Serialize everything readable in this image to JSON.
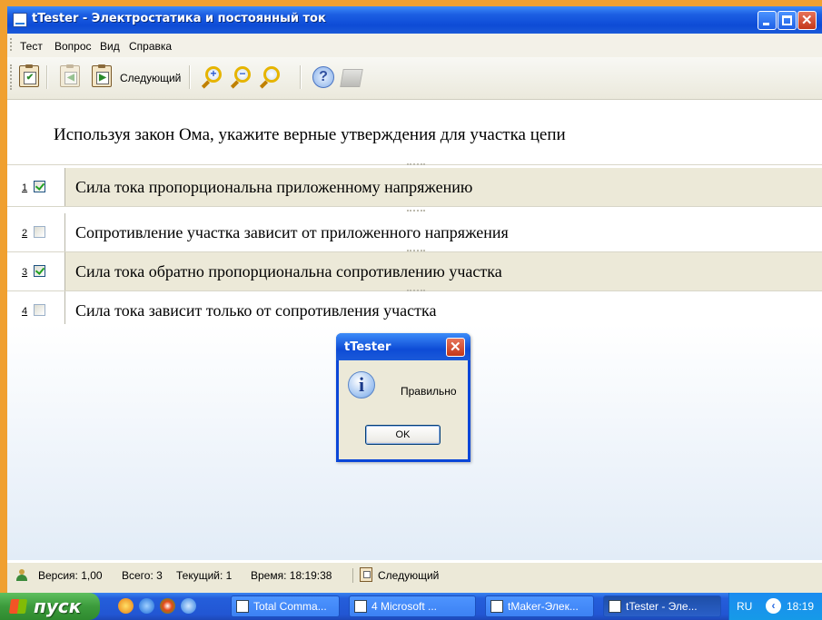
{
  "window": {
    "title": "tTester - Электростатика и постоянный ток"
  },
  "menu": [
    "Тест",
    "Вопрос",
    "Вид",
    "Справка"
  ],
  "toolbar": {
    "next_label": "Следующий"
  },
  "question": {
    "text": "Используя закон Ома, укажите верные утверждения для участка цепи"
  },
  "answers": [
    {
      "num": "1",
      "checked": true,
      "text": "Сила тока пропорциональна приложенному напряжению"
    },
    {
      "num": "2",
      "checked": false,
      "text": "Сопротивление участка зависит от приложенного напряжения"
    },
    {
      "num": "3",
      "checked": true,
      "text": "Сила тока обратно пропорциональна сопротивлению участка"
    },
    {
      "num": "4",
      "checked": false,
      "text": "Сила тока зависит только от сопротивления участка"
    }
  ],
  "status": {
    "version": "Версия: 1,00",
    "total": "Всего: 3",
    "current": "Текущий: 1",
    "time": "Время: 18:19:38",
    "next": "Следующий"
  },
  "dialog": {
    "title": "tTester",
    "message": "Правильно",
    "ok": "OK"
  },
  "taskbar": {
    "start": "пуск",
    "tasks": [
      "Total Comma...",
      "4 Microsoft ...",
      "tMaker-Элек...",
      "tTester - Эле..."
    ],
    "lang": "RU",
    "clock": "18:19"
  },
  "colors": {
    "titlebar": "#0d4bd6",
    "selected_row": "#ece9d8",
    "taskbar": "#245edb",
    "start": "#3c9b3c"
  }
}
